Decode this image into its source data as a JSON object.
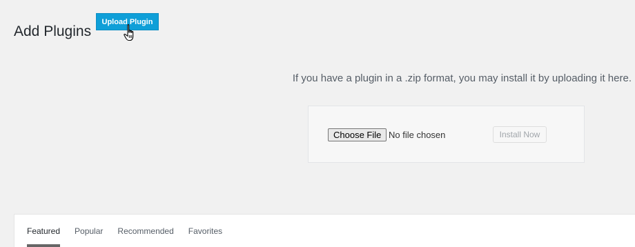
{
  "header": {
    "title": "Add Plugins",
    "upload_button": "Upload Plugin"
  },
  "upload": {
    "help_text": "If you have a plugin in a .zip format, you may install it by uploading it here.",
    "choose_file": "Choose File",
    "file_status": "No file chosen",
    "install_button": "Install Now"
  },
  "tabs": [
    {
      "label": "Featured",
      "active": true
    },
    {
      "label": "Popular",
      "active": false
    },
    {
      "label": "Recommended",
      "active": false
    },
    {
      "label": "Favorites",
      "active": false
    }
  ],
  "colors": {
    "accent": "#0f9fd8",
    "background": "#f1f1f1"
  },
  "icons": {
    "cursor": "hand-pointer-icon"
  }
}
